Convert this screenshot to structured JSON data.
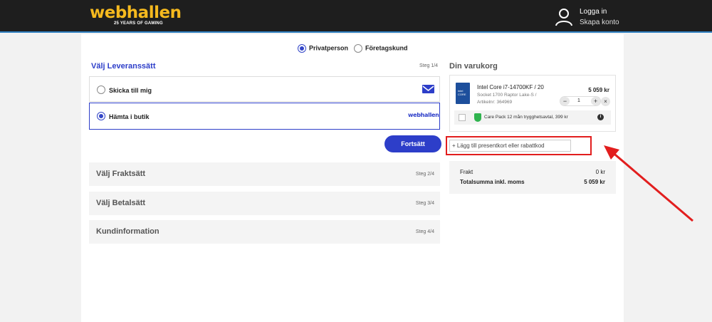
{
  "header": {
    "logo_text": "webhallen",
    "logo_tagline": "25 YEARS OF GAMING",
    "login_label": "Logga in",
    "create_account_label": "Skapa konto"
  },
  "customer_type": {
    "private": "Privatperson",
    "business": "Företagskund",
    "selected": "Privatperson"
  },
  "delivery": {
    "title": "Välj Leveranssätt",
    "step": "Steg 1/4",
    "options": [
      {
        "label": "Skicka till mig",
        "icon": "mail-icon",
        "selected": false
      },
      {
        "label": "Hämta i butik",
        "icon": "webhallen-logo-icon",
        "brand_text": "webhallen",
        "selected": true
      }
    ],
    "continue_label": "Fortsätt"
  },
  "steps": [
    {
      "title": "Välj Fraktsätt",
      "step": "Steg 2/4"
    },
    {
      "title": "Välj Betalsätt",
      "step": "Steg 3/4"
    },
    {
      "title": "Kundinformation",
      "step": "Steg 4/4"
    }
  ],
  "cart": {
    "title": "Din varukorg",
    "item": {
      "name": "Intel Core i7-14700KF / 20",
      "sub_line1": "Socket 1700 Raptor Lake-S /",
      "sub_line2": "Artikelnr: 364969",
      "price": "5 059 kr",
      "quantity": "1",
      "minus": "−",
      "plus": "+",
      "remove": "×"
    },
    "care_pack": "Care Pack 12 mån trygghetsavtal, 399 kr",
    "coupon_label": "+ Lägg till presentkort eller rabattkod",
    "totals": [
      {
        "label": "Frakt",
        "value": "0 kr"
      },
      {
        "label": "Totalsumma inkl. moms",
        "value": "5 059 kr"
      }
    ]
  },
  "colors": {
    "accent": "#2d3ec9",
    "header_bg": "#1e1e1e",
    "logo": "#f5b91e",
    "annotation": "#e21e1e"
  }
}
